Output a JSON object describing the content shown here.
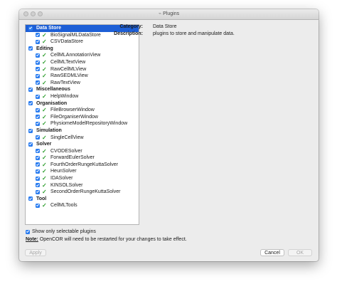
{
  "window": {
    "title": "Plugins"
  },
  "tree": [
    {
      "category": "Data Store",
      "selected": true,
      "items": [
        "BioSignalMLDataStore",
        "CSVDataStore"
      ]
    },
    {
      "category": "Editing",
      "items": [
        "CellMLAnnotationView",
        "CellMLTextView",
        "RawCellMLView",
        "RawSEDMLView",
        "RawTextView"
      ]
    },
    {
      "category": "Miscellaneous",
      "items": [
        "HelpWindow"
      ]
    },
    {
      "category": "Organisation",
      "items": [
        "FileBrowserWindow",
        "FileOrganiserWindow",
        "PhysiomeModelRepositoryWindow"
      ]
    },
    {
      "category": "Simulation",
      "items": [
        "SingleCellView"
      ]
    },
    {
      "category": "Solver",
      "items": [
        "CVODESolver",
        "ForwardEulerSolver",
        "FourthOrderRungeKuttaSolver",
        "HeunSolver",
        "IDASolver",
        "KINSOLSolver",
        "SecondOrderRungeKuttaSolver"
      ]
    },
    {
      "category": "Tool",
      "items": [
        "CellMLTools"
      ]
    }
  ],
  "details": {
    "category_label": "Category:",
    "category_value": "Data Store",
    "description_label": "Description:",
    "description_value": "plugins to store and manipulate data."
  },
  "options": {
    "show_selectable_label": "Show only selectable plugins"
  },
  "note": {
    "label": "Note:",
    "text": " OpenCOR will need to be restarted for your changes to take effect."
  },
  "buttons": {
    "apply": "Apply",
    "cancel": "Cancel",
    "ok": "OK"
  },
  "colors": {
    "selection": "#1d5fd6",
    "checkbox": "#2b7df0",
    "tick": "#2f9e2f"
  }
}
